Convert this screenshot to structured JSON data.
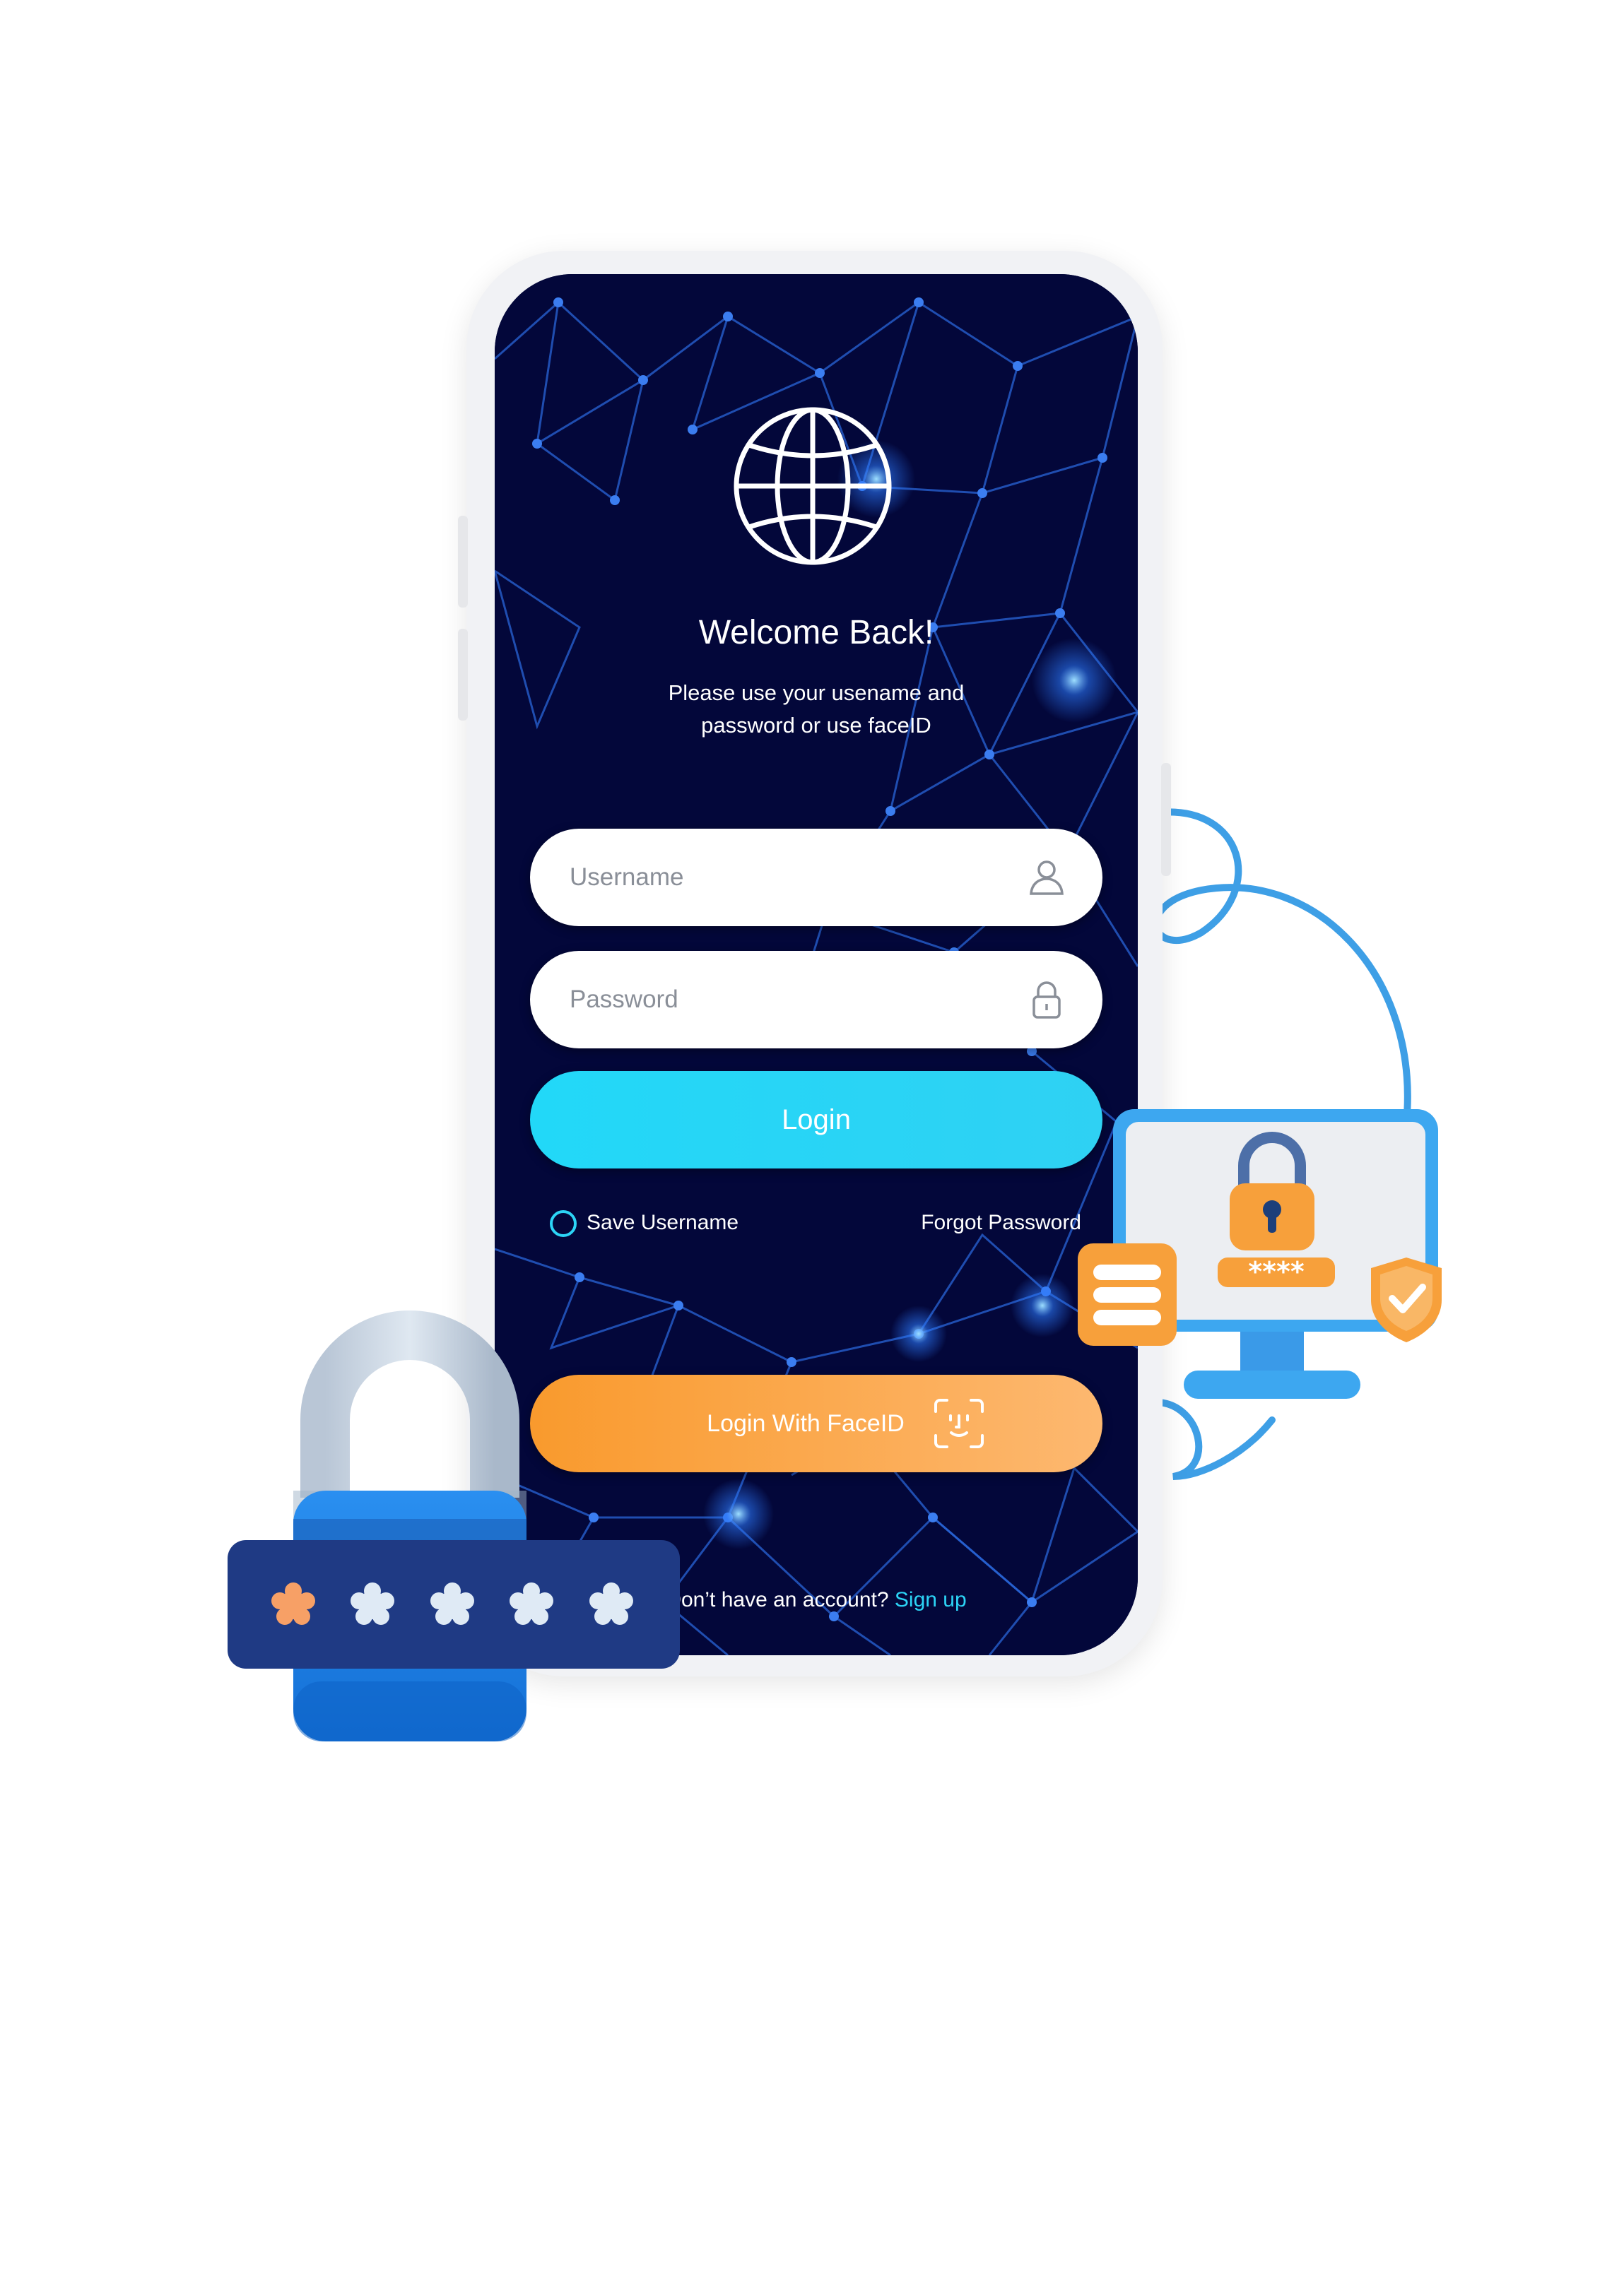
{
  "login_screen": {
    "title": "Welcome Back!",
    "subtitle": "Please use your  usename and password or use faceID",
    "username_placeholder": "Username",
    "password_placeholder": "Password",
    "login_label": "Login",
    "save_username_label": "Save Username",
    "forgot_password_label": "Forgot Password",
    "faceid_label": "Login With FaceID",
    "signup_prompt": "Don’t have an account?",
    "signup_link": "Sign up"
  },
  "icons": {
    "logo": "globe-icon",
    "username": "user-icon",
    "password": "lock-icon",
    "faceid": "face-id-icon"
  },
  "illustrations": {
    "padlock_password_dots": 5,
    "monitor_password_stars": "****"
  },
  "colors": {
    "screen_background": "#03073a",
    "network_lines": "#2f6fe0",
    "login_button": "#22d8f8",
    "faceid_button": "#f99a2d",
    "link": "#2cd4f6",
    "padlock_body": "#1d7fe0",
    "padlock_band": "#1f3a84",
    "monitor_frame": "#3da7f0",
    "accent_orange": "#f7a03b"
  }
}
